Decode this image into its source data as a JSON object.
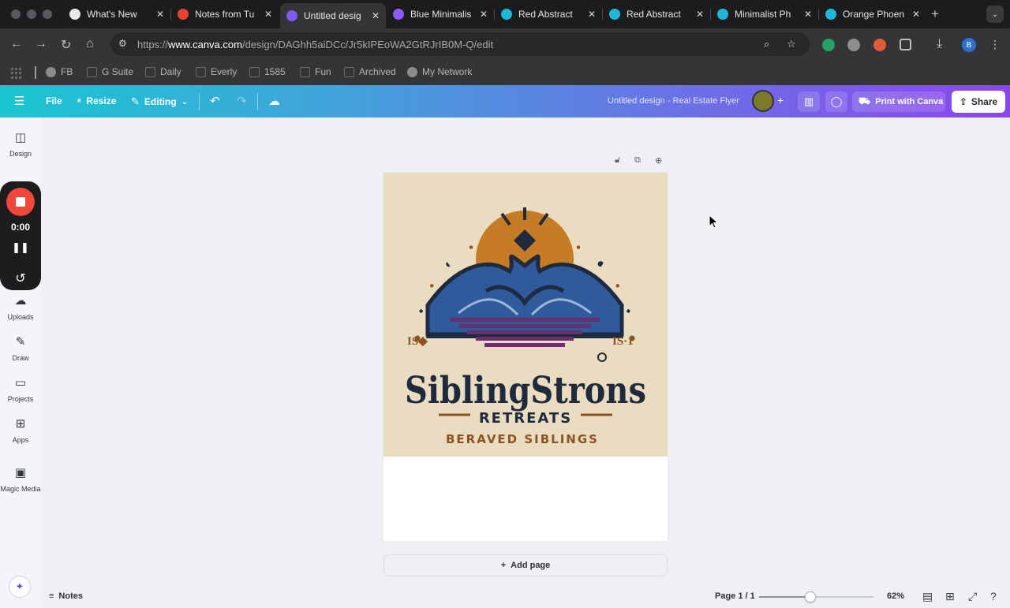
{
  "browser": {
    "tabs": [
      {
        "title": "What's New",
        "icon": "chrome-icon",
        "color": "#e8e8e8"
      },
      {
        "title": "Notes from Tu",
        "icon": "gmail-icon",
        "color": "#ea4335"
      },
      {
        "title": "Untitled desig",
        "icon": "canva-doc-icon",
        "color": "#7d5cf5",
        "active": true
      },
      {
        "title": "Blue Minimalis",
        "icon": "canva-heart-icon",
        "color": "#8b5cf6"
      },
      {
        "title": "Red Abstract",
        "icon": "canva-icon",
        "color": "#1eb8d6"
      },
      {
        "title": "Red Abstract",
        "icon": "canva-icon",
        "color": "#1eb8d6"
      },
      {
        "title": "Minimalist Ph",
        "icon": "canva-icon",
        "color": "#1eb8d6"
      },
      {
        "title": "Orange Phoen",
        "icon": "canva-icon",
        "color": "#1eb8d6"
      }
    ],
    "url_prefix": "https://",
    "url_domain": "www.canva.com",
    "url_path": "/design/DAGhh5aiDCc/Jr5kIPEoWA2GtRJrIB0M-Q/edit",
    "profile_initial": "B",
    "bookmarks": [
      {
        "label": "FB",
        "icon": "globe"
      },
      {
        "label": "G Suite",
        "icon": "folder"
      },
      {
        "label": "Daily",
        "icon": "folder"
      },
      {
        "label": "Everly",
        "icon": "folder"
      },
      {
        "label": "1585",
        "icon": "folder"
      },
      {
        "label": "Fun",
        "icon": "folder"
      },
      {
        "label": "Archived",
        "icon": "folder"
      },
      {
        "label": "My Network",
        "icon": "globe"
      }
    ]
  },
  "canva": {
    "file_label": "File",
    "resize_label": "Resize",
    "editing_label": "Editing",
    "doc_title": "Untitled design - Real Estate Flyer",
    "print_label": "Print with Canva",
    "share_label": "Share",
    "sidebar": [
      {
        "label": "Design",
        "icon": "design-icon",
        "glyph": "◫"
      },
      {
        "label": "Uploads",
        "icon": "upload-cloud-icon",
        "glyph": "☁"
      },
      {
        "label": "Draw",
        "icon": "pen-icon",
        "glyph": "✎"
      },
      {
        "label": "Projects",
        "icon": "folder-icon",
        "glyph": "▭"
      },
      {
        "label": "Apps",
        "icon": "apps-icon",
        "glyph": "⊞"
      },
      {
        "label": "Magic Media",
        "icon": "magic-media-icon",
        "glyph": "▣"
      }
    ],
    "recorder_time": "0:00",
    "add_page_label": "Add page",
    "notes_label": "Notes",
    "page_indicator": "Page 1 / 1",
    "zoom_label": "62%",
    "zoom_fraction": 0.45
  },
  "artwork": {
    "left_mark": "IS◆",
    "right_mark": "IS·1",
    "title": "SiblingStrons",
    "subtitle": "RETREATS",
    "tagline": "BERAVED SIBLINGS",
    "colors": {
      "background": "#eadcc0",
      "navy": "#1e2a3d",
      "gold": "#c67c24",
      "blue": "#2f5a9c",
      "purple": "#6b2f6e",
      "brown": "#8c5220"
    }
  }
}
